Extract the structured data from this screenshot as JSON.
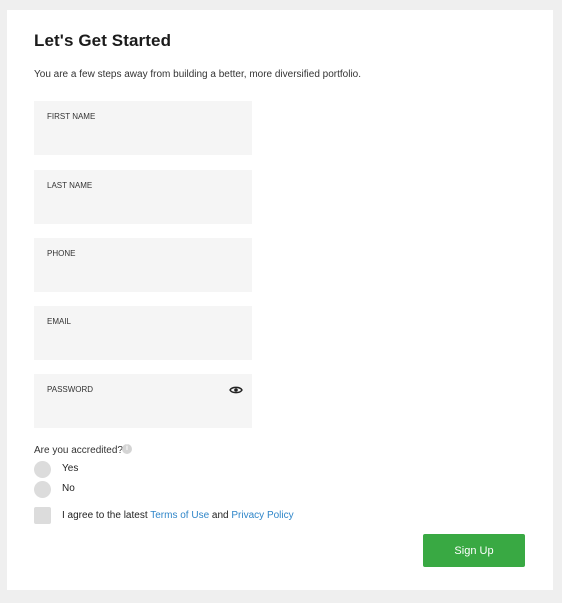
{
  "header": {
    "title": "Let's Get Started",
    "subtitle": "You are a few steps away from building a better, more diversified portfolio."
  },
  "fields": {
    "first_name": {
      "label": "FIRST NAME",
      "value": ""
    },
    "last_name": {
      "label": "LAST NAME",
      "value": ""
    },
    "phone": {
      "label": "PHONE",
      "value": ""
    },
    "email": {
      "label": "EMAIL",
      "value": ""
    },
    "password": {
      "label": "PASSWORD",
      "value": "",
      "toggle_icon": "eye-icon"
    }
  },
  "accredited": {
    "question": "Are you accredited?",
    "info_icon": "info-icon",
    "info_glyph": "i",
    "options": [
      {
        "label": "Yes",
        "selected": false
      },
      {
        "label": "No",
        "selected": false
      }
    ]
  },
  "agreement": {
    "prefix": "I agree to the latest",
    "terms_link": "Terms of Use",
    "conjunction": "and",
    "privacy_link": "Privacy Policy",
    "checked": false
  },
  "actions": {
    "signup_label": "Sign Up"
  },
  "colors": {
    "background": "#efefef",
    "card": "#ffffff",
    "field_bg": "#f5f5f5",
    "accent_green": "#39a943",
    "link_blue": "#2f86c9",
    "control_gray": "#dcdcdc"
  }
}
